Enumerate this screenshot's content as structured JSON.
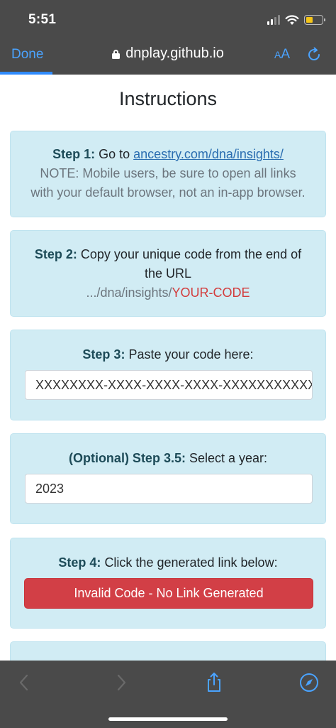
{
  "status_bar": {
    "time": "5:51"
  },
  "browser": {
    "done_label": "Done",
    "url": "dnplay.github.io",
    "text_size_small": "A",
    "text_size_large": "A"
  },
  "page": {
    "title": "Instructions",
    "step1": {
      "label": "Step 1:",
      "text": "Go to",
      "link": "ancestry.com/dna/insights/",
      "note_line1": "NOTE: Mobile users, be sure to open all links",
      "note_line2": "with your default browser, not an in-app browser."
    },
    "step2": {
      "label": "Step 2:",
      "text_line1": "Copy your unique code from the end of",
      "text_line2": "the URL",
      "url_prefix": ".../dna/insights/",
      "url_code": "YOUR-CODE"
    },
    "step3": {
      "label": "Step 3:",
      "text": "Paste your code here:",
      "input_placeholder": "XXXXXXXX-XXXX-XXXX-XXXX-XXXXXXXXXXXX"
    },
    "step35": {
      "label": "(Optional) Step 3.5:",
      "text": "Select a year:",
      "year_value": "2023"
    },
    "step4": {
      "label": "Step 4:",
      "text": "Click the generated link below:",
      "button_label": "Invalid Code - No Link Generated"
    }
  },
  "colors": {
    "card_bg": "#d1ecf4",
    "error_button": "#d23f46",
    "browser_accent": "#4aa3ff",
    "browser_chrome": "#4a4a4a"
  },
  "icons": [
    "wifi-icon",
    "battery-icon",
    "lock-icon",
    "reload-icon",
    "back-icon",
    "forward-icon",
    "share-icon",
    "compass-icon"
  ]
}
